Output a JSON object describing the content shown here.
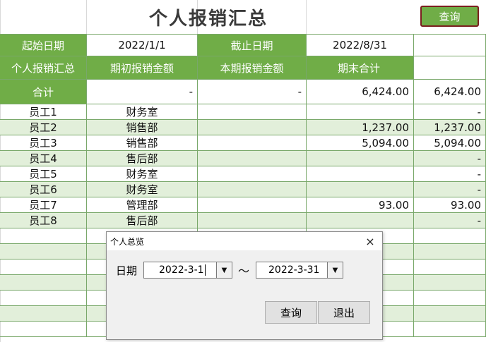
{
  "title": "个人报销汇总",
  "query_button": "查询",
  "row1": {
    "start_label": "起始日期",
    "start_value": "2022/1/1",
    "end_label": "截止日期",
    "end_value": "2022/8/31"
  },
  "headers": [
    "个人报销汇总",
    "期初报销金额",
    "本期报销金额",
    "期末合计"
  ],
  "totals": {
    "label": "合计",
    "opening": "-",
    "current": "-",
    "closing": "6,424.00",
    "extra": "6,424.00"
  },
  "employees": [
    {
      "name": "员工1",
      "dept": "财务室",
      "closing": "",
      "extra": "-"
    },
    {
      "name": "员工2",
      "dept": "销售部",
      "closing": "1,237.00",
      "extra": "1,237.00"
    },
    {
      "name": "员工3",
      "dept": "销售部",
      "closing": "5,094.00",
      "extra": "5,094.00"
    },
    {
      "name": "员工4",
      "dept": "售后部",
      "closing": "",
      "extra": "-"
    },
    {
      "name": "员工5",
      "dept": "财务室",
      "closing": "",
      "extra": "-"
    },
    {
      "name": "员工6",
      "dept": "财务室",
      "closing": "",
      "extra": "-"
    },
    {
      "name": "员工7",
      "dept": "管理部",
      "closing": "93.00",
      "extra": "93.00"
    },
    {
      "name": "员工8",
      "dept": "售后部",
      "closing": "",
      "extra": "-"
    }
  ],
  "dialog": {
    "title": "个人总览",
    "close_icon": "×",
    "date_label": "日期",
    "from_date": "2022-3-1",
    "separator": "～",
    "to_date": "2022-3-31",
    "dropdown_icon": "▼",
    "query_label": "查询",
    "exit_label": "退出"
  },
  "colors": {
    "header_green": "#70ad47",
    "band_light": "#e2efda",
    "border_green": "#79a86a",
    "button_border": "#7b1e1e"
  }
}
